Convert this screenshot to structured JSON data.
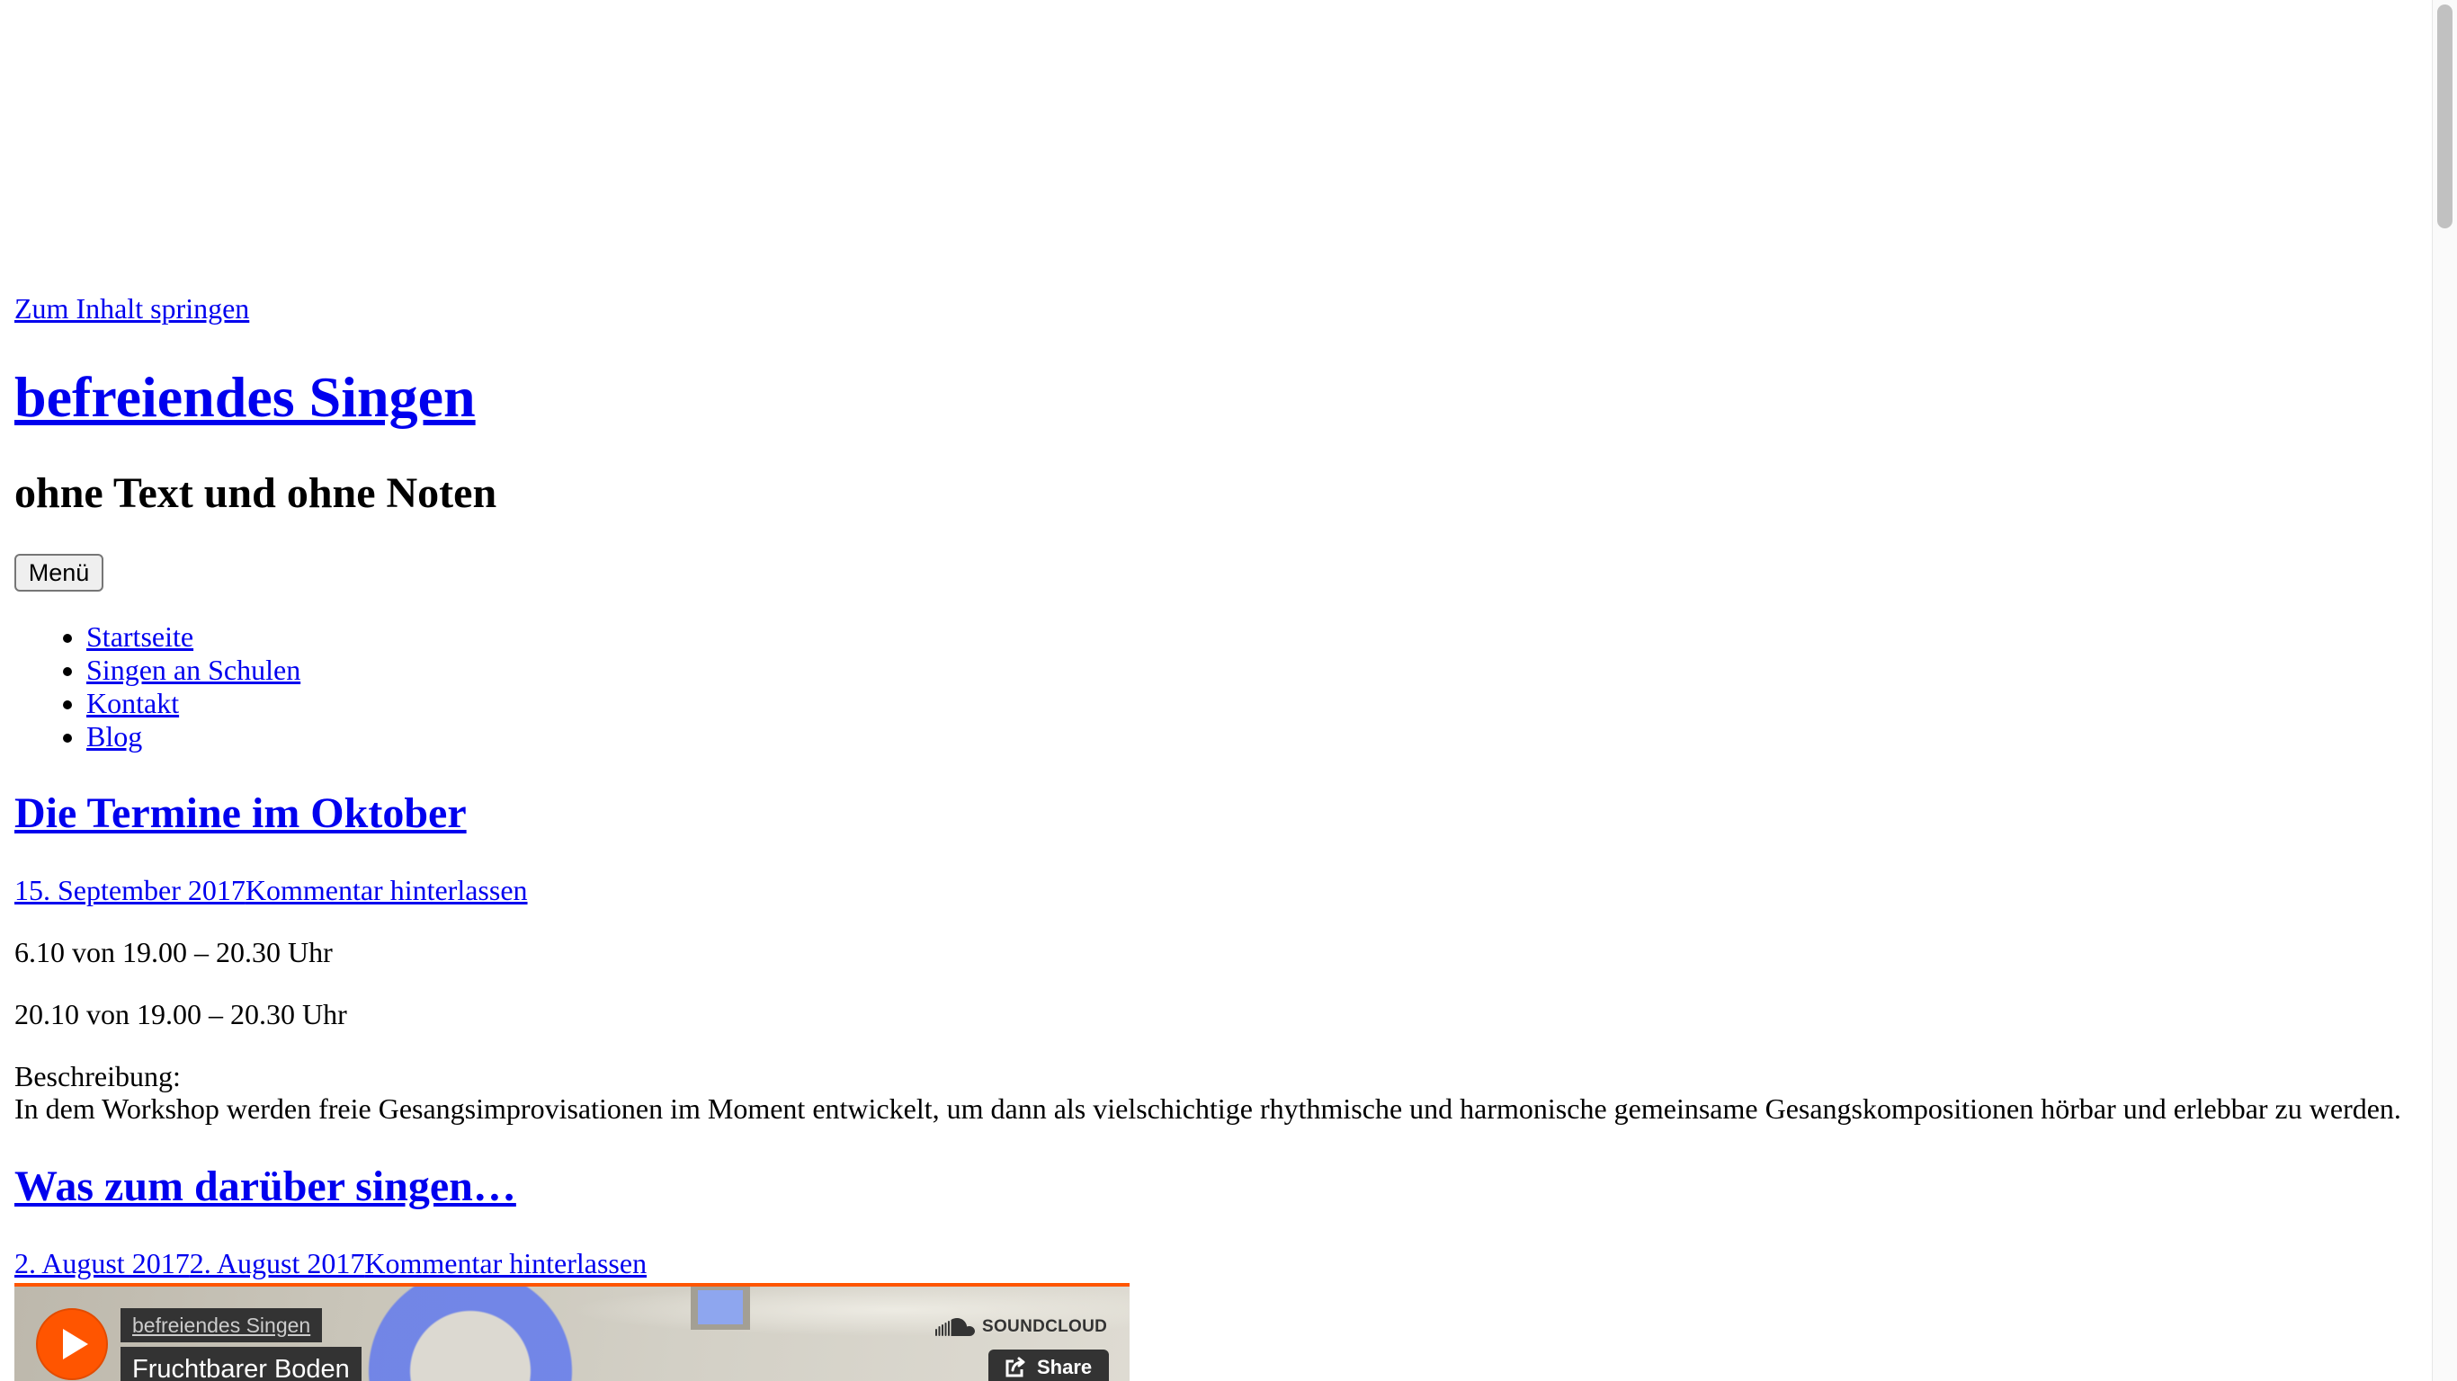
{
  "theme": {
    "link_color": "#0000ee",
    "text_color": "#000000",
    "accent_color": "#ff5500"
  },
  "header": {
    "skip_link": "Zum Inhalt springen",
    "site_title": "befreiendes Singen",
    "site_description": "ohne Text und ohne Noten",
    "menu_button": "Menü"
  },
  "nav": {
    "items": [
      {
        "label": "Startseite"
      },
      {
        "label": "Singen an Schulen"
      },
      {
        "label": "Kontakt"
      },
      {
        "label": "Blog"
      }
    ]
  },
  "posts": [
    {
      "title": "Die Termine im Oktober",
      "meta": {
        "date": "15. September 2017",
        "comments_link": "Kommentar hinterlassen"
      },
      "content": {
        "dates": [
          "6.10 von 19.00 – 20.30 Uhr",
          "20.10 von 19.00 – 20.30 Uhr"
        ],
        "description_label": "Beschreibung:",
        "description": "In dem Workshop werden freie Gesangsimprovisationen im Moment entwickelt, um dann als vielschichtige rhythmische und harmonische gemeinsame Gesangskompositionen hörbar und erlebbar zu werden."
      }
    },
    {
      "title": "Was zum darüber singen…",
      "meta": {
        "date": "2. August 2017",
        "updated": "2. August 2017",
        "comments_link": "Kommentar hinterlassen"
      },
      "embed": {
        "brand": "SOUNDCLOUD",
        "artist": "befreiendes Singen",
        "track": "Fruchtbarer Boden",
        "share_label": "Share",
        "icons": {
          "play": "play-icon",
          "logo": "soundcloud-cloud-icon",
          "share": "share-icon"
        }
      }
    }
  ],
  "scrollbar": {
    "scroll_position": 0
  }
}
